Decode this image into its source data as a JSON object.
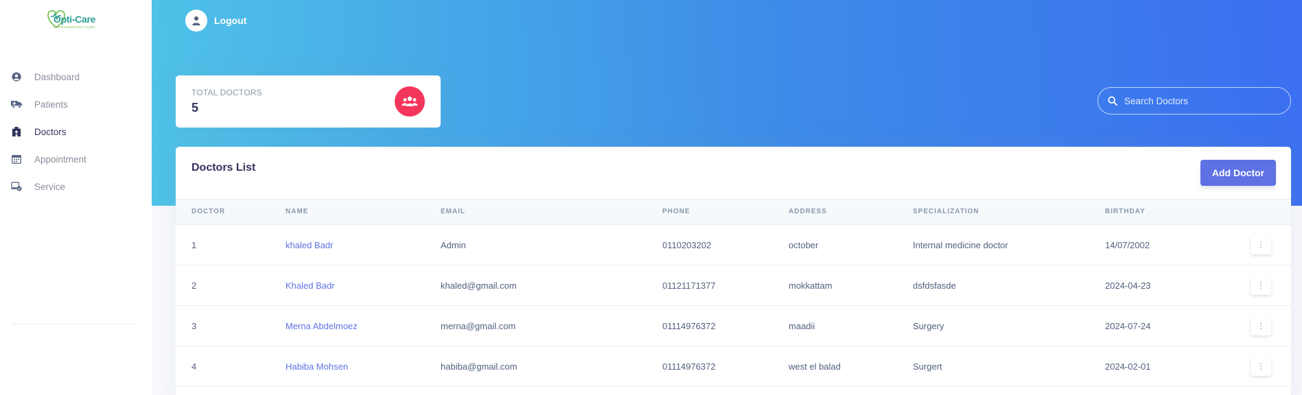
{
  "brand": {
    "name": "Opti-Care",
    "tagline": "OPHTHALMOLOGY CLINIC",
    "colors": {
      "primary": "#2a9d8f",
      "secondary": "#6cbe45"
    }
  },
  "sidebar": {
    "items": [
      {
        "label": "Dashboard",
        "icon": "user-circle-icon",
        "active": false
      },
      {
        "label": "Patients",
        "icon": "ambulance-icon",
        "active": false
      },
      {
        "label": "Doctors",
        "icon": "hospital-icon",
        "active": true
      },
      {
        "label": "Appointment",
        "icon": "calendar-icon",
        "active": false
      },
      {
        "label": "Service",
        "icon": "laptop-service-icon",
        "active": false
      }
    ]
  },
  "header": {
    "user_label": "Logout",
    "avatar_icon": "user-icon",
    "gradient": [
      "#4fc3e8",
      "#3b6ff0"
    ]
  },
  "stats": {
    "title": "TOTAL DOCTORS",
    "value": "5",
    "icon": "users-icon",
    "icon_color": "#f5365c"
  },
  "search": {
    "placeholder": "Search Doctors",
    "value": ""
  },
  "doctors_list": {
    "title": "Doctors List",
    "add_button": "Add Doctor",
    "columns": [
      "DOCTOR",
      "NAME",
      "EMAIL",
      "PHONE",
      "ADDRESS",
      "SPECIALIZATION",
      "BIRTHDAY"
    ],
    "rows": [
      {
        "id": "1",
        "name": "khaled Badr",
        "email": "Admin",
        "phone": "0110203202",
        "address": "october",
        "specialization": "Internal medicine doctor",
        "birthday": "14/07/2002"
      },
      {
        "id": "2",
        "name": "Khaled Badr",
        "email": "khaled@gmail.com",
        "phone": "01121171377",
        "address": "mokkattam",
        "specialization": "dsfdsfasde",
        "birthday": "2024-04-23"
      },
      {
        "id": "3",
        "name": "Merna Abdelmoez",
        "email": "merna@gmail.com",
        "phone": "01114976372",
        "address": "maadii",
        "specialization": "Surgery",
        "birthday": "2024-07-24"
      },
      {
        "id": "4",
        "name": "Habiba Mohsen",
        "email": "habiba@gmail.com",
        "phone": "01114976372",
        "address": "west el balad",
        "specialization": "Surgert",
        "birthday": "2024-02-01"
      }
    ]
  }
}
